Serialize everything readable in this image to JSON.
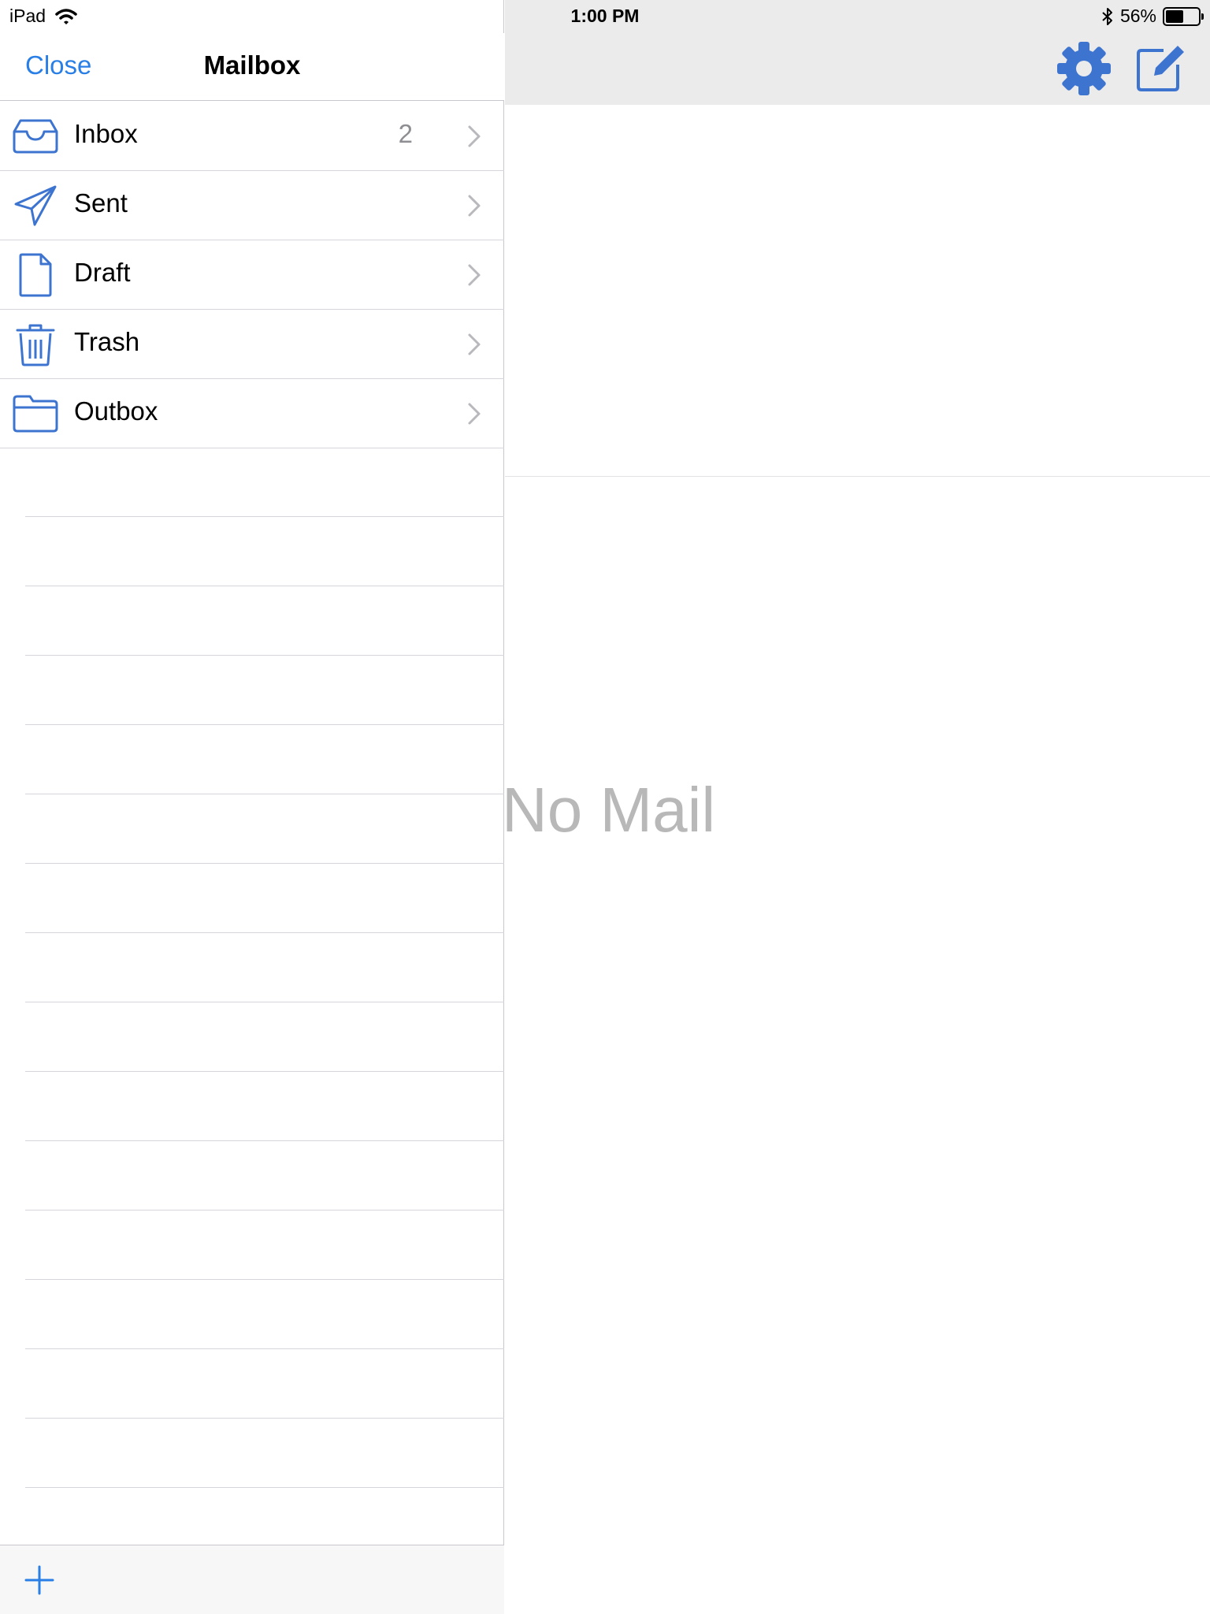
{
  "status_bar": {
    "device": "iPad",
    "time": "1:00 PM",
    "battery_text": "56%",
    "battery_level": 0.56,
    "icons": [
      "wifi-icon",
      "bluetooth-icon",
      "battery-icon"
    ]
  },
  "sidebar": {
    "close_label": "Close",
    "title": "Mailbox",
    "folders": [
      {
        "label": "Inbox",
        "count": "2",
        "icon": "inbox-tray-icon"
      },
      {
        "label": "Sent",
        "count": "",
        "icon": "paper-plane-icon"
      },
      {
        "label": "Draft",
        "count": "",
        "icon": "document-icon"
      },
      {
        "label": "Trash",
        "count": "",
        "icon": "trash-icon"
      },
      {
        "label": "Outbox",
        "count": "",
        "icon": "folder-icon"
      }
    ],
    "add_icon": "plus-icon"
  },
  "detail": {
    "empty_message": "No Mail",
    "toolbar_icons": [
      "gear-icon",
      "compose-icon"
    ]
  },
  "colors": {
    "accent": "#2a7fe6",
    "icon_blue": "#3d74d0",
    "placeholder_gray": "#b8b8b8",
    "toolbar_bg": "#ebebeb"
  }
}
